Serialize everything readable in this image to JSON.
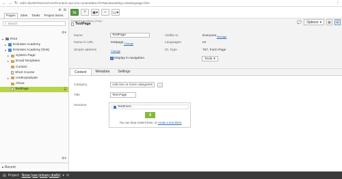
{
  "browser": {
    "url": "eafm-dev/EPiServer/Cms/#context=epi.cms.contentdata:///375&viewsetting=viewlanguage:///en"
  },
  "left_panel": {
    "tabs": [
      "Pages",
      "Sites",
      "Tasks",
      "Project Items"
    ],
    "search_placeholder": "Search",
    "tree": [
      {
        "label": "Root",
        "icon": "root",
        "level": 0,
        "toggle": "▾"
      },
      {
        "label": "Emirates Academy",
        "icon": "site",
        "level": 1,
        "toggle": "▸"
      },
      {
        "label": "Emirates Academy [Test]",
        "icon": "site",
        "level": 1,
        "toggle": "▾"
      },
      {
        "label": "System Page",
        "icon": "folder",
        "level": 2,
        "toggle": "▸"
      },
      {
        "label": "Email Templates",
        "icon": "folder",
        "level": 2,
        "toggle": "▸"
      },
      {
        "label": "Contact",
        "icon": "folder",
        "level": 2,
        "toggle": ""
      },
      {
        "label": "Short Course",
        "icon": "page",
        "level": 2,
        "toggle": ""
      },
      {
        "label": "Undergraduate",
        "icon": "folder",
        "level": 2,
        "toggle": "▸"
      },
      {
        "label": "About",
        "icon": "folder",
        "level": 2,
        "toggle": ""
      },
      {
        "label": "TestPage",
        "icon": "page",
        "level": 2,
        "toggle": "",
        "selected": true
      }
    ],
    "recent_label": "Recent"
  },
  "header": {
    "breadcrumb": "Emirates Academy [Test] ›",
    "title": "TestPage",
    "options_label": "Options"
  },
  "properties": {
    "name_label": "Name",
    "name_value": "TestPage",
    "url_label": "Name in URL",
    "url_value": "testpage",
    "url_change": "Change",
    "simple_label": "Simple address",
    "simple_change": "Change",
    "nav_label": "Display in navigation",
    "visible_label": "Visible to",
    "visible_value": "Everyone",
    "visible_manage": "Manage",
    "lang_label": "Languages",
    "lang_value": "en",
    "id_label": "ID, Type",
    "id_value": "757, Form Page",
    "tools_label": "Tools"
  },
  "content_tabs": [
    "Content",
    "Metadata",
    "Settings"
  ],
  "content": {
    "category_label": "Category",
    "category_placeholder": "Add one or more categories",
    "title_label": "Title",
    "title_value": "Test Page",
    "sections_label": "Sections",
    "block_name": "TestForm",
    "drop_text": "You can drop content here, or",
    "drop_link": "create a new block"
  },
  "bottom_bar": {
    "project_label": "Project:",
    "project_value": "None (use primary drafts)"
  },
  "colors": {
    "selected_node": "#b8d44c",
    "publish_green": "#5d9a46",
    "drop_green": "#8ab83c",
    "bottom_bar": "#3a3a3a"
  }
}
